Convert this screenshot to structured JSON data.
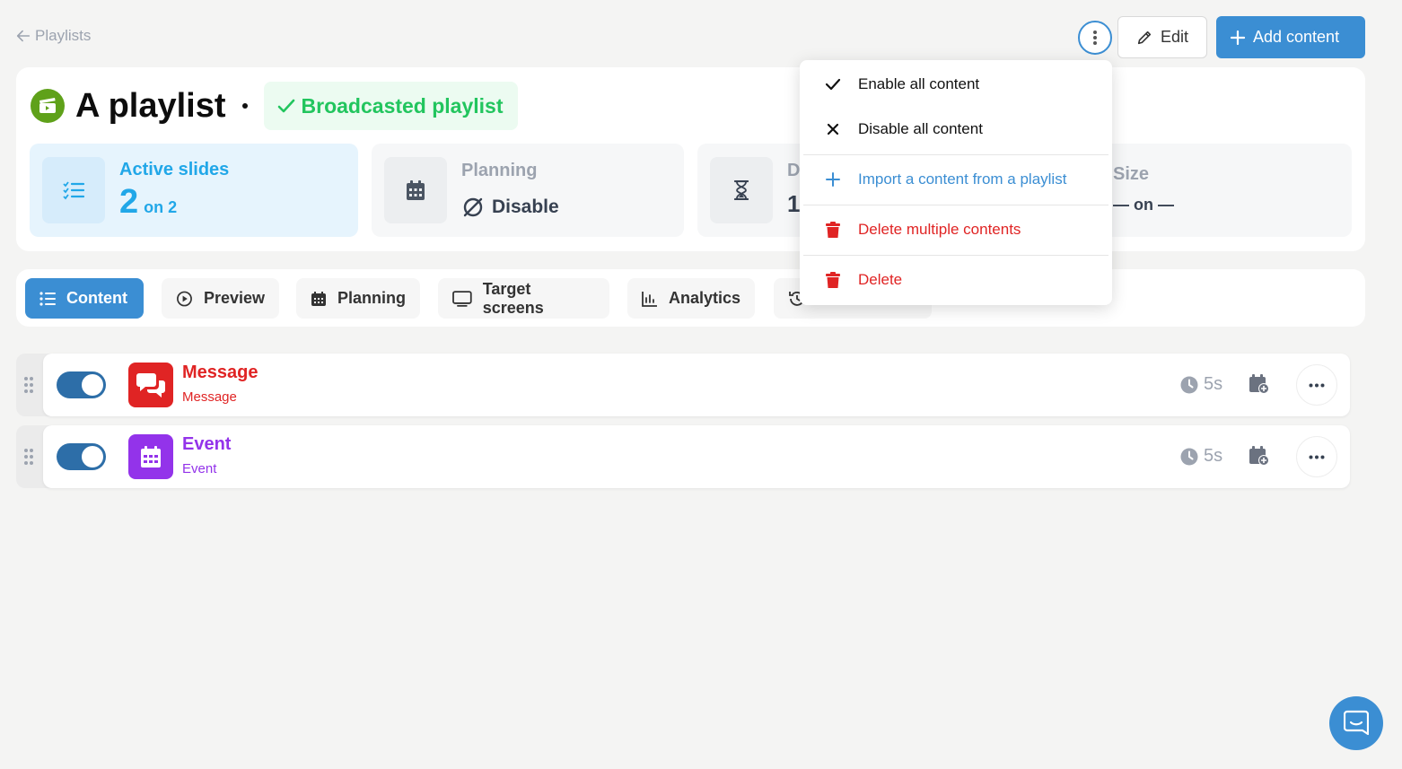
{
  "breadcrumb": {
    "back_label": "Playlists"
  },
  "actions": {
    "edit_label": "Edit",
    "add_label": "Add content"
  },
  "playlist": {
    "title": "A playlist",
    "status": "Broadcasted playlist"
  },
  "stats": {
    "active": {
      "label": "Active slides",
      "count": "2",
      "total": "on 2"
    },
    "planning": {
      "label": "Planning",
      "value": "Disable"
    },
    "duration": {
      "label_visible": "D",
      "value_visible": "1"
    },
    "size": {
      "label": "Size",
      "value": "— on —"
    }
  },
  "tabs": [
    {
      "label": "Content",
      "active": true,
      "icon": "list-icon"
    },
    {
      "label": "Preview",
      "icon": "play-circle-icon"
    },
    {
      "label": "Planning",
      "icon": "calendar-icon"
    },
    {
      "label": "Target screens",
      "icon": "monitor-icon"
    },
    {
      "label": "Analytics",
      "icon": "chart-icon"
    },
    {
      "label": "",
      "icon": "history-icon"
    }
  ],
  "contents": [
    {
      "title": "Message",
      "type": "Message",
      "duration": "5s",
      "enabled": true,
      "color": "#e02424",
      "icon": "comments-icon"
    },
    {
      "title": "Event",
      "type": "Event",
      "duration": "5s",
      "enabled": true,
      "color": "#9333ea",
      "icon": "calendar-icon"
    }
  ],
  "menu": {
    "enable_all": "Enable all content",
    "disable_all": "Disable all content",
    "import": "Import a content from a playlist",
    "delete_multiple": "Delete multiple contents",
    "delete": "Delete"
  },
  "colors": {
    "accent": "#3b8ed3",
    "success": "#22c55e",
    "danger": "#e02424",
    "info": "#21a7e8"
  }
}
